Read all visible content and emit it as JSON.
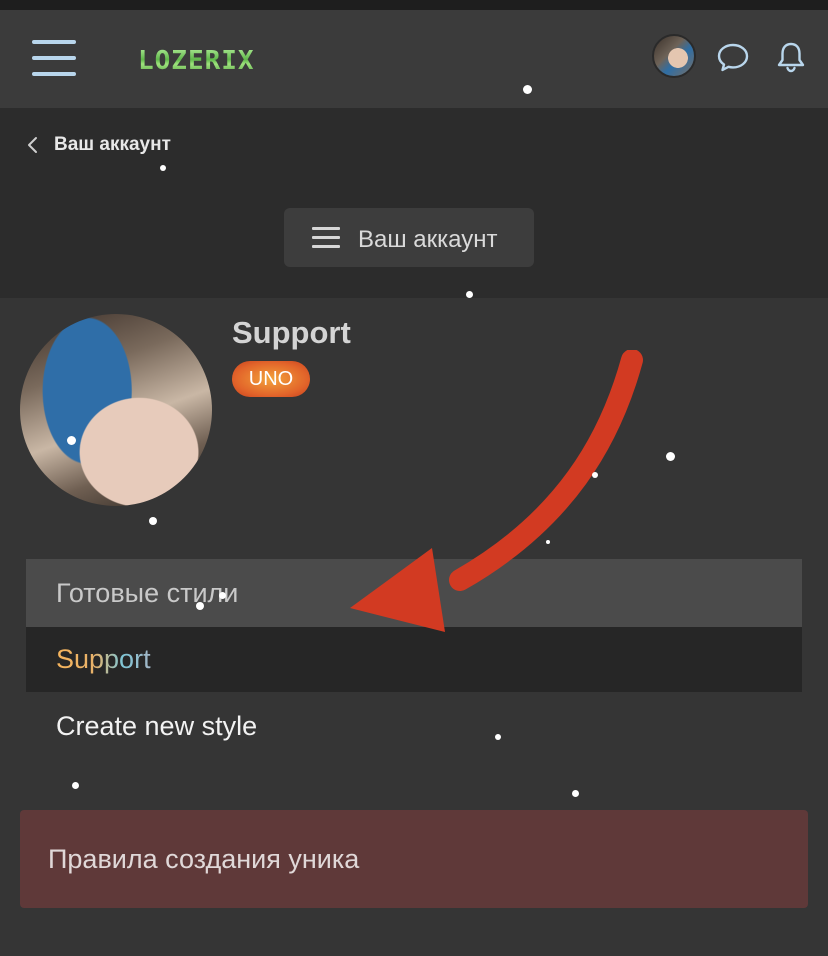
{
  "header": {
    "logo_text": "LOZERIX",
    "icons": [
      "menu-icon",
      "user-avatar",
      "chat-icon",
      "bell-icon"
    ],
    "accent_color": "#b9d6ec"
  },
  "breadcrumb": {
    "back_icon": "chevron-left-icon",
    "label": "Ваш аккаунт"
  },
  "page_title_button": {
    "icon": "menu-icon",
    "label": "Ваш аккаунт"
  },
  "profile": {
    "name": "Support",
    "badge": "UNO",
    "badge_color": "#e2642a"
  },
  "menu": {
    "items": [
      {
        "label": "Готовые стили",
        "state": "highlighted"
      },
      {
        "label": "Support",
        "state": "selected"
      },
      {
        "label": "Create new style",
        "state": "default"
      }
    ]
  },
  "rules_banner": {
    "label": "Правила создания уника",
    "color": "#5f3939"
  },
  "annotation": {
    "arrow_color": "#d23a22"
  }
}
